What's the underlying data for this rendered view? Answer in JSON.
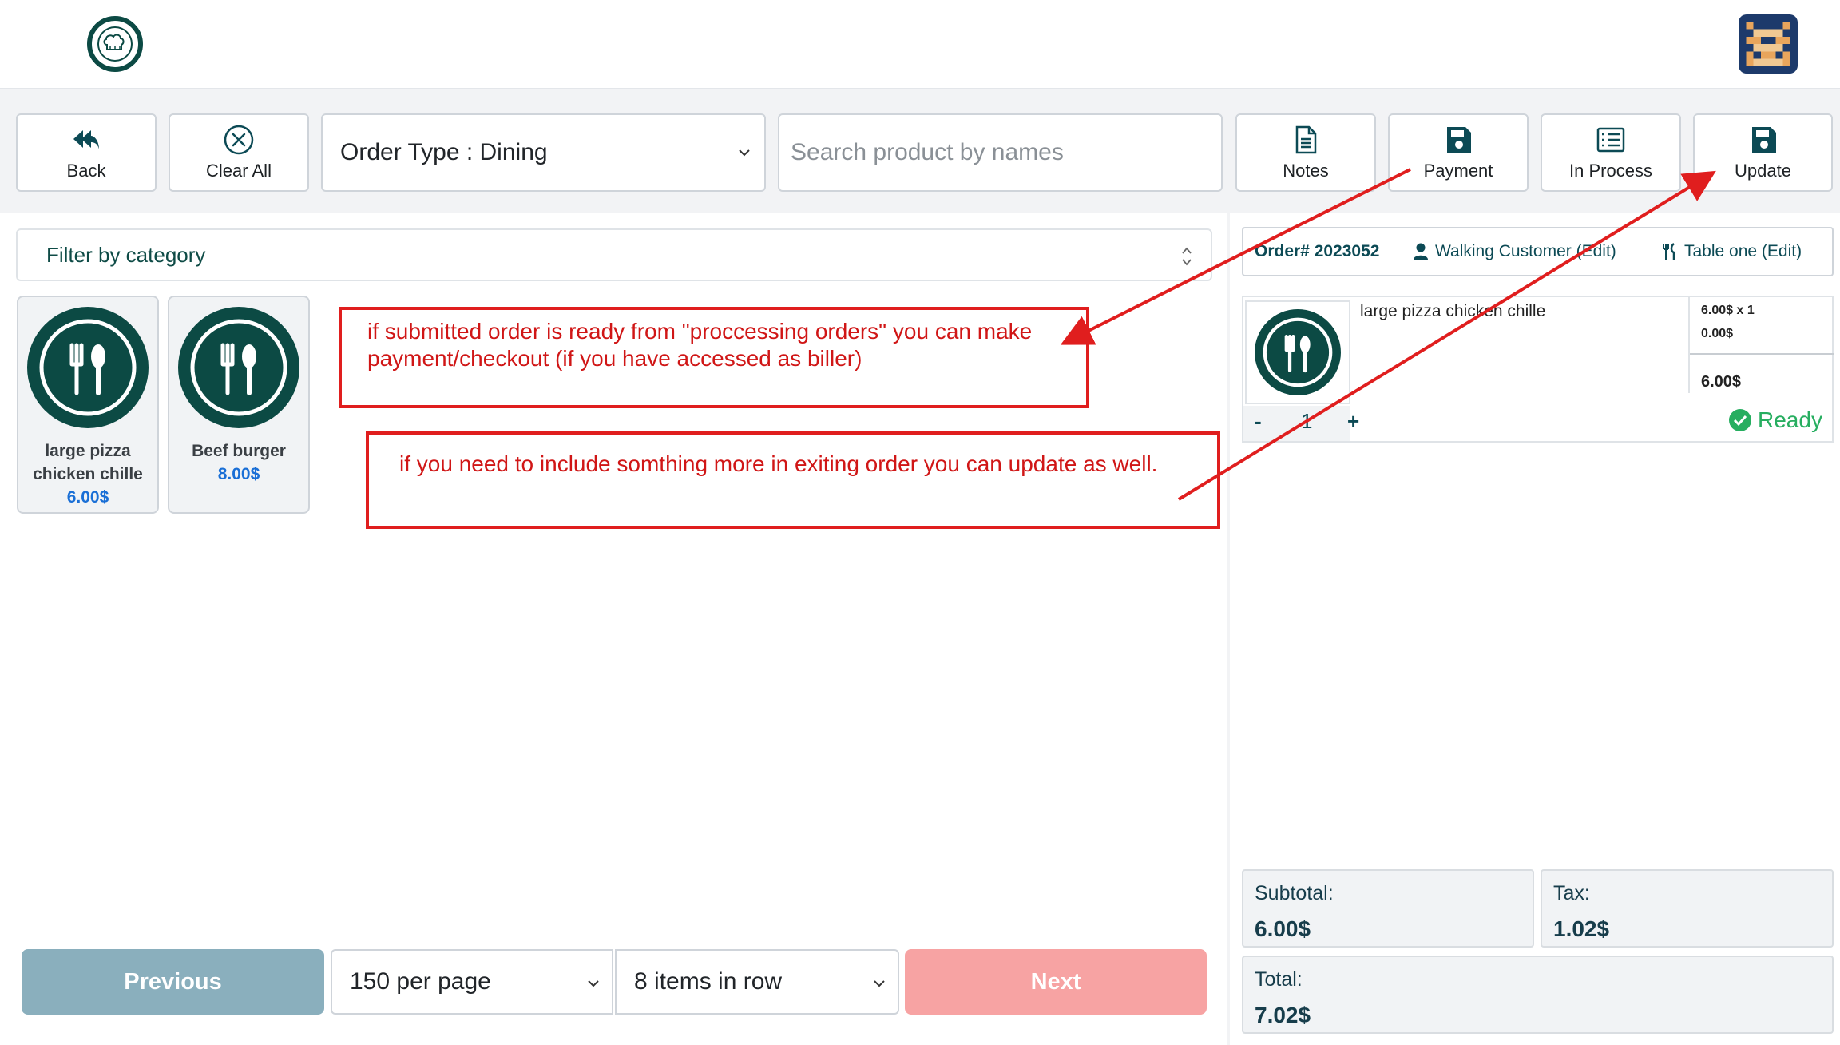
{
  "header": {
    "logo_icon": "chef-hat-logo-icon",
    "avatar_icon": "pixel-avatar-icon"
  },
  "toolbar": {
    "back_label": "Back",
    "clear_all_label": "Clear All",
    "order_type_value": "Order Type : Dining",
    "search_placeholder": "Search product by names",
    "notes_label": "Notes",
    "payment_label": "Payment",
    "in_process_label": "In Process",
    "update_label": "Update"
  },
  "filter": {
    "label": "Filter by category"
  },
  "products": [
    {
      "name_line1": "large pizza",
      "name_line2": "chicken chille",
      "price": "6.00$",
      "icon": "fork-spoon-plate-icon"
    },
    {
      "name_line1": "Beef burger",
      "name_line2": "",
      "price": "8.00$",
      "icon": "fork-spoon-plate-icon"
    }
  ],
  "annotations": {
    "payment_note_line1": "if submitted order is ready from \"proccessing orders\" you can make",
    "payment_note_line2": "payment/checkout (if you have accessed as biller)",
    "update_note": "if you need to include somthing more in exiting order you can update as well."
  },
  "pager": {
    "previous_label": "Previous",
    "per_page_value": "150 per page",
    "items_in_row_value": "8 items in row",
    "next_label": "Next"
  },
  "order": {
    "number": "Order# 2023052",
    "customer": "Walking Customer (Edit)",
    "table": "Table one (Edit)",
    "item": {
      "name": "large pizza chicken chille",
      "unit_qty": "6.00$ x 1",
      "discount": "0.00$",
      "line_total": "6.00$",
      "minus": "-",
      "qty": "1",
      "plus": "+",
      "status": "Ready"
    }
  },
  "totals": {
    "subtotal_label": "Subtotal:",
    "subtotal_value": "6.00$",
    "tax_label": "Tax:",
    "tax_value": "1.02$",
    "total_label": "Total:",
    "total_value": "7.02$"
  },
  "colors": {
    "brand_dark_green": "#0c4a44",
    "annotation_red": "#e01e1e",
    "previous_button": "#8aafbd",
    "next_button": "#f7a3a3",
    "price_blue": "#1a6fd6",
    "ready_green": "#27ae60"
  }
}
